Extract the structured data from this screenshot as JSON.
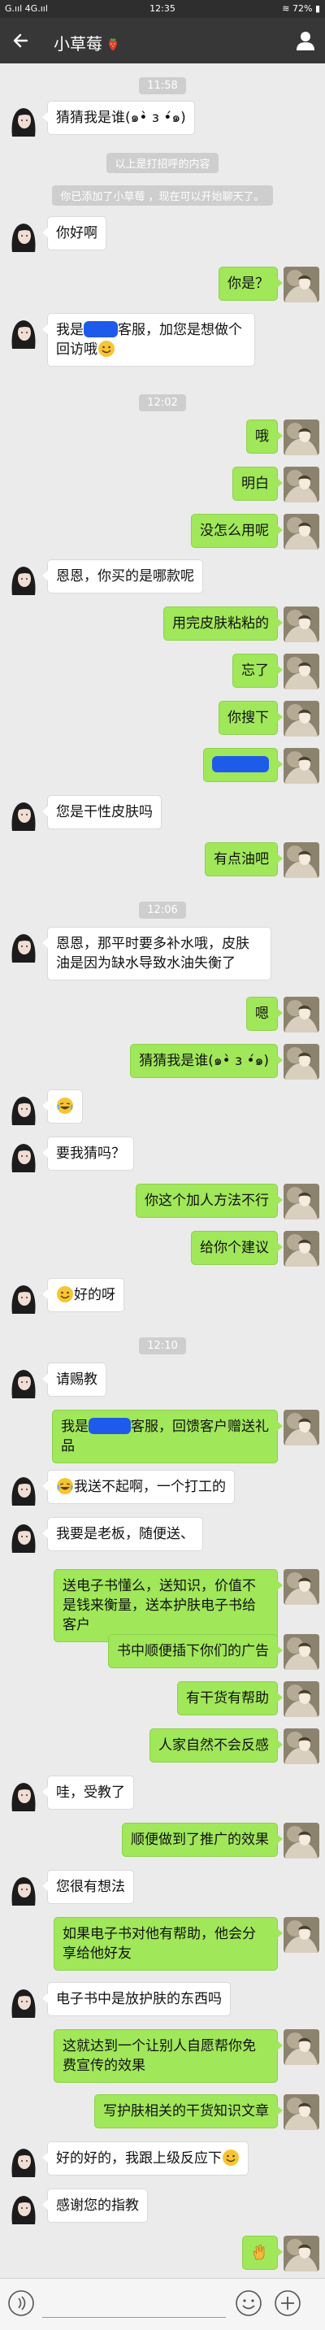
{
  "status_bar": {
    "left": "G.ııl 4G.ııl",
    "time": "12:35",
    "battery": "72%"
  },
  "header": {
    "title": "小草莓"
  },
  "timestamps": [
    "11:58",
    "12:02",
    "12:06",
    "12:10"
  ],
  "system": {
    "hello_hint": "以上是打招呼的内容",
    "added_notice": "你已添加了小草莓 ，现在可以开始聊天了。"
  },
  "messages": {
    "m01": "猜猜我是谁(๑•̀ з •́๑)",
    "m02": "你好啊",
    "m03": "你是？",
    "m04a": "我是",
    "m04b": "客服，加您是想做个回访哦",
    "m05": "哦",
    "m06": "明白",
    "m07": "没怎么用呢",
    "m08": "恩恩，你买的是哪款呢",
    "m09": "用完皮肤粘粘的",
    "m10": "忘了",
    "m11": "你搜下",
    "m13": "您是干性皮肤吗",
    "m14": "有点油吧",
    "m15": "恩恩，那平时要多补水哦，皮肤油是因为缺水导致水油失衡了",
    "m16": "嗯",
    "m17": "猜猜我是谁(๑•̀ з •́๑)",
    "m19": "要我猜吗？",
    "m20": "你这个加人方法不行",
    "m21": "给你个建议",
    "m22": "好的呀",
    "m23": "请赐教",
    "m24a": "我是",
    "m24b": "客服，回馈客户赠送礼品",
    "m25": "我送不起啊，一个打工的",
    "m26": "我要是老板，随便送、",
    "m27": "送电子书懂么，送知识，价值不是钱来衡量，送本护肤电子书给客户",
    "m28": "书中顺便插下你们的广告",
    "m29": "有干货有帮助",
    "m30": "人家自然不会反感",
    "m31": "哇，受教了",
    "m32": "顺便做到了推广的效果",
    "m33": "您很有想法",
    "m34": "如果电子书对他有帮助，他会分享给他好友",
    "m35": "电子书中是放护肤的东西吗",
    "m36": "这就达到一个让别人自愿帮你免费宣传的效果",
    "m37": "写护肤相关的干货知识文章",
    "m38": "好的好的，我跟上级反应下",
    "m39": "感谢您的指教"
  },
  "emoji_names": [
    "smile-emoji",
    "laugh-tears-emoji",
    "clap-emoji"
  ]
}
